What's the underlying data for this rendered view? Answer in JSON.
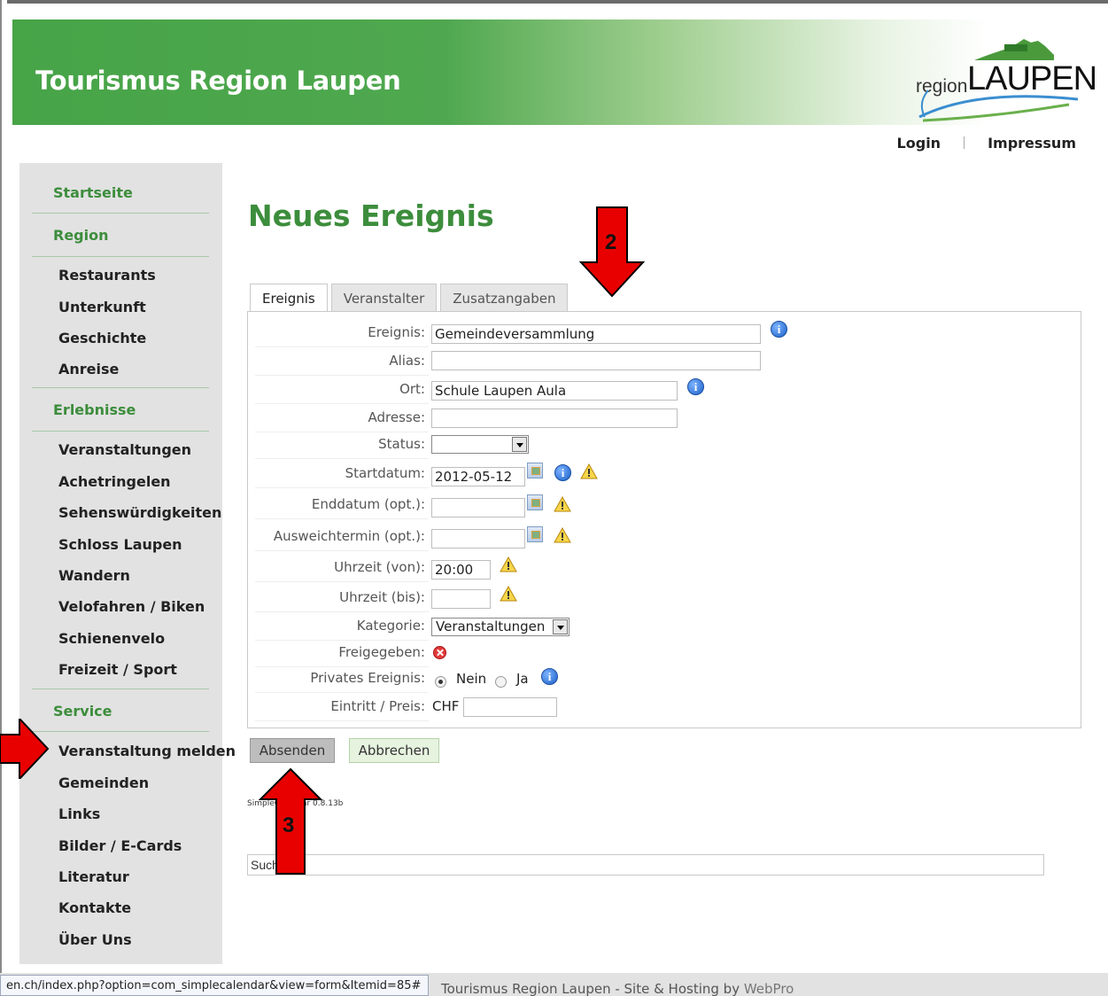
{
  "header": {
    "site_title": "Tourismus Region Laupen",
    "logo_region": "region",
    "logo_laupen": "LAUPEN"
  },
  "topnav": {
    "login": "Login",
    "impressum": "Impressum"
  },
  "sidebar": {
    "sections": [
      {
        "label": "Startseite"
      },
      {
        "label": "Region"
      },
      {
        "label": "Erlebnisse"
      },
      {
        "label": "Service"
      }
    ],
    "region_items": [
      "Restaurants",
      "Unterkunft",
      "Geschichte",
      "Anreise"
    ],
    "erlebnisse_items": [
      "Veranstaltungen",
      "Achetringelen",
      "Sehenswürdigkeiten",
      "Schloss Laupen",
      "Wandern",
      "Velofahren / Biken",
      "Schienenvelo",
      "Freizeit / Sport"
    ],
    "service_items": [
      "Veranstaltung melden",
      "Gemeinden",
      "Links",
      "Bilder / E-Cards",
      "Literatur",
      "Kontakte",
      "Über Uns"
    ]
  },
  "page": {
    "title": "Neues Ereignis"
  },
  "tabs": [
    "Ereignis",
    "Veranstalter",
    "Zusatzangaben"
  ],
  "form": {
    "ereignis": {
      "label": "Ereignis:",
      "value": "Gemeindeversammlung"
    },
    "alias": {
      "label": "Alias:",
      "value": ""
    },
    "ort": {
      "label": "Ort:",
      "value": "Schule Laupen Aula"
    },
    "adresse": {
      "label": "Adresse:",
      "value": ""
    },
    "status": {
      "label": "Status:",
      "value": ""
    },
    "startdatum": {
      "label": "Startdatum:",
      "value": "2012-05-12"
    },
    "enddatum": {
      "label": "Enddatum (opt.):",
      "value": ""
    },
    "ausweich": {
      "label": "Ausweichtermin (opt.):",
      "value": ""
    },
    "uhrzeit_von": {
      "label": "Uhrzeit (von):",
      "value": "20:00"
    },
    "uhrzeit_bis": {
      "label": "Uhrzeit (bis):",
      "value": ""
    },
    "kategorie": {
      "label": "Kategorie:",
      "value": "Veranstaltungen"
    },
    "freigegeben": {
      "label": "Freigegeben:"
    },
    "privat": {
      "label": "Privates Ereignis:",
      "opt_no": "Nein",
      "opt_yes": "Ja"
    },
    "eintritt": {
      "label": "Eintritt / Preis:",
      "currency": "CHF",
      "value": ""
    }
  },
  "buttons": {
    "submit": "Absenden",
    "cancel": "Abbrechen"
  },
  "version": "SimpleCalendar 0.8.13b",
  "search": {
    "value": "Suchen..."
  },
  "footer": {
    "text": "Tourismus Region Laupen - Site & Hosting by ",
    "link": "WebPro"
  },
  "statusbar": {
    "url": "en.ch/index.php?option=com_simplecalendar&view=form&Itemid=85#"
  },
  "annotations": {
    "arrow2": "2",
    "arrow3": "3"
  },
  "colors": {
    "brand_green": "#47a447",
    "nav_green": "#3c8d3c",
    "arrow_red": "#e80000"
  }
}
